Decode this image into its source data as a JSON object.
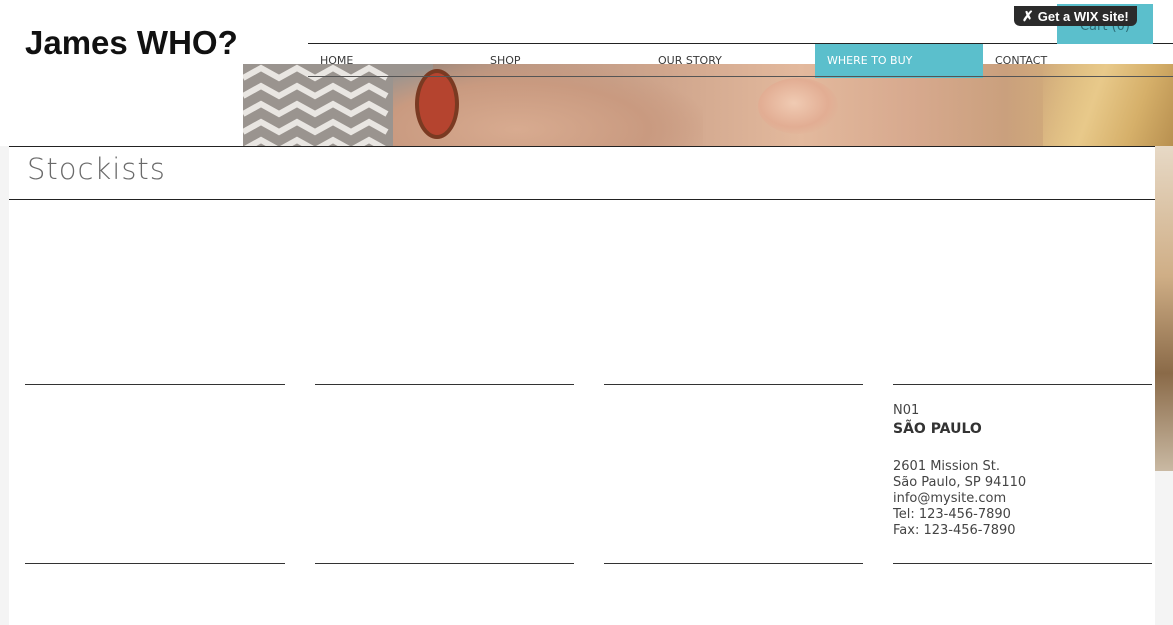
{
  "site": {
    "logo": "James WHO?"
  },
  "nav": {
    "items": [
      {
        "label": "HOME"
      },
      {
        "label": "SHOP"
      },
      {
        "label": "OUR STORY"
      },
      {
        "label": "WHERE TO BUY",
        "active": true
      },
      {
        "label": "CONTACT"
      }
    ],
    "active_color": "#5bbfcc"
  },
  "cart": {
    "label": "Cart (0)"
  },
  "wix_badge": {
    "label": "Get a WIX site!"
  },
  "page": {
    "title": "Stockists"
  },
  "stores": [
    {
      "code": "N01",
      "city": "SÃO PAULO",
      "address_line1": "2601 Mission St.",
      "address_line2": "São Paulo, SP 94110",
      "email": "info@mysite.com",
      "tel": "Tel: 123-456-7890",
      "fax": "Fax: 123-456-7890"
    }
  ]
}
